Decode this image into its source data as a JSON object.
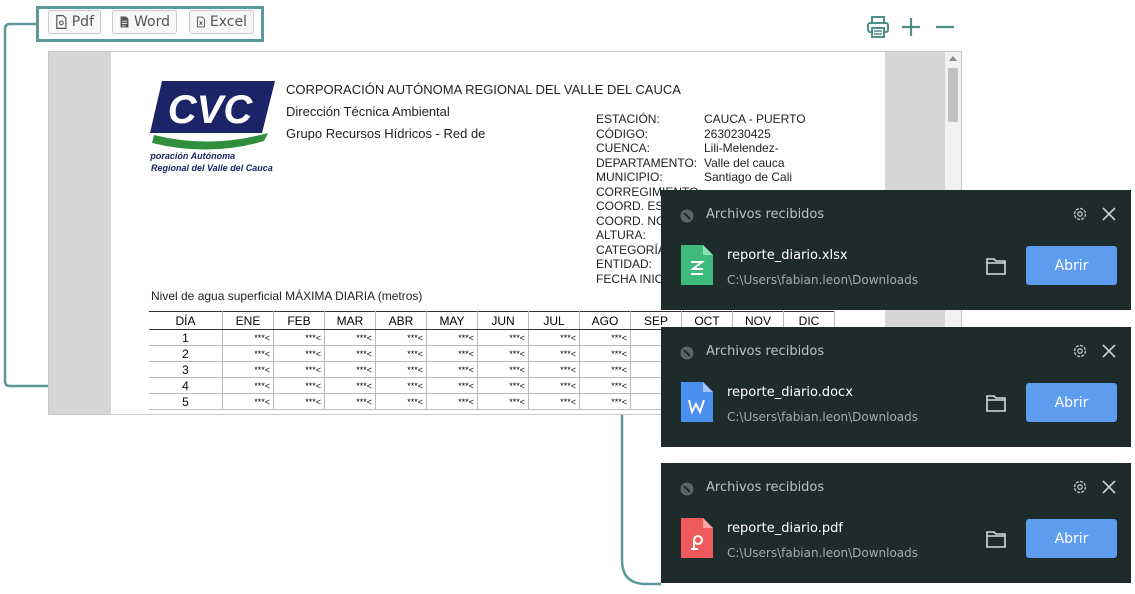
{
  "toolbar": {
    "export_buttons": [
      {
        "label": "Pdf"
      },
      {
        "label": "Word"
      },
      {
        "label": "Excel"
      }
    ],
    "icons": [
      "printer-icon",
      "plus-icon",
      "minus-icon"
    ]
  },
  "document": {
    "header": {
      "org": "CORPORACIÓN AUTÓNOMA  REGIONAL DEL VALLE DEL CAUCA",
      "line2": "Dirección Técnica Ambiental",
      "line3": "Grupo Recursos Hídricos - Red de"
    },
    "logo": {
      "text": "CVC",
      "caption1": "Corporación Autónoma",
      "caption2": "Regional del Valle del Cauca"
    },
    "station_labels": [
      "ESTACIÓN:",
      "CÓDIGO:",
      "CUENCA:",
      "DEPARTAMENTO:",
      "MUNICIPIO:",
      "CORREGIMIENTO:",
      "COORD. ES",
      "COORD. NO",
      "ALTURA:",
      "CATEGORÍA",
      "ENTIDAD:",
      "FECHA INIC"
    ],
    "station_values": [
      "CAUCA - PUERTO",
      "2630230425",
      "Lili-Melendez-",
      "Valle del cauca",
      "Santiago de Cali"
    ],
    "table_title": "Nivel de agua superficial MÁXIMA DIARIA  (metros)",
    "columns": [
      "DÍA",
      "ENE",
      "FEB",
      "MAR",
      "ABR",
      "MAY",
      "JUN",
      "JUL",
      "AGO",
      "SEP",
      "OCT",
      "NOV",
      "DIC"
    ],
    "rows": [
      {
        "day": "1",
        "cells": [
          "***<",
          "***<",
          "***<",
          "***<",
          "***<",
          "***<",
          "***<",
          "***<",
          "",
          "",
          "",
          ""
        ]
      },
      {
        "day": "2",
        "cells": [
          "***<",
          "***<",
          "***<",
          "***<",
          "***<",
          "***<",
          "***<",
          "***<",
          "",
          "",
          "",
          ""
        ]
      },
      {
        "day": "3",
        "cells": [
          "***<",
          "***<",
          "***<",
          "***<",
          "***<",
          "***<",
          "***<",
          "***<",
          "",
          "",
          "",
          ""
        ]
      },
      {
        "day": "4",
        "cells": [
          "***<",
          "***<",
          "***<",
          "***<",
          "***<",
          "***<",
          "***<",
          "***<",
          "",
          "",
          "",
          ""
        ]
      },
      {
        "day": "5",
        "cells": [
          "***<",
          "***<",
          "***<",
          "***<",
          "***<",
          "***<",
          "***<",
          "***<",
          "",
          "",
          "",
          ""
        ]
      }
    ]
  },
  "notifications": [
    {
      "title": "Archivos recibidos",
      "file_name": "reporte_diario.xlsx",
      "path": "C:\\Users\\fabian.leon\\Downloads",
      "button": "Abrir",
      "file_type": "xlsx",
      "color": "#3fba7d"
    },
    {
      "title": "Archivos recibidos",
      "file_name": "reporte_diario.docx",
      "path": "C:\\Users\\fabian.leon\\Downloads",
      "button": "Abrir",
      "file_type": "docx",
      "color": "#4a8ef0"
    },
    {
      "title": "Archivos recibidos",
      "file_name": "reporte_diario.pdf",
      "path": "C:\\Users\\fabian.leon\\Downloads",
      "button": "Abrir",
      "file_type": "pdf",
      "color": "#f05a5a"
    }
  ],
  "colors": {
    "accent_connector": "#5a9a98",
    "notif_bg": "#1d2b2b",
    "open_button": "#5e9cf0"
  }
}
